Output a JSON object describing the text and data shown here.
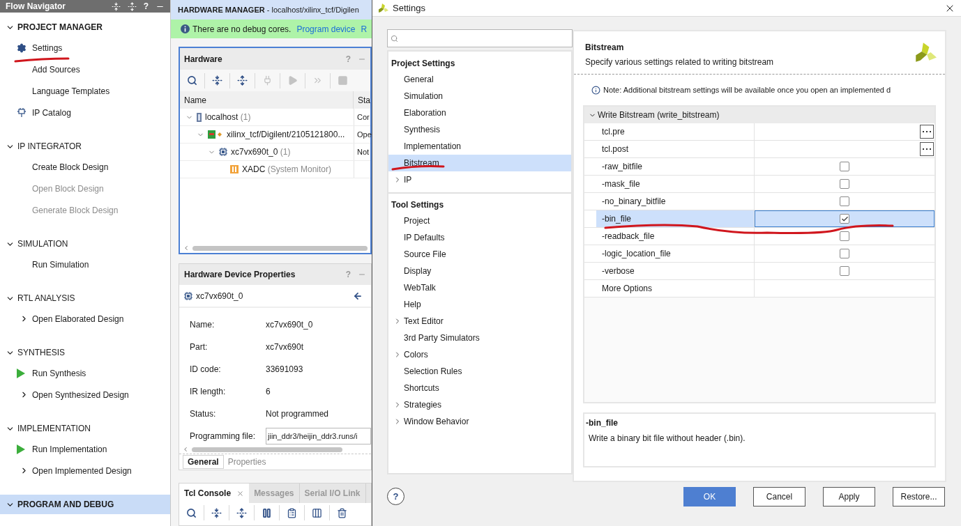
{
  "flow_navigator": {
    "title": "Flow Navigator",
    "help": "?",
    "sections": [
      {
        "title": "PROJECT MANAGER",
        "expanded": true,
        "active": true,
        "selected": false,
        "items": [
          {
            "label": "Settings",
            "kind": "gear",
            "disabled": false
          },
          {
            "label": "Add Sources",
            "kind": "plain",
            "disabled": false
          },
          {
            "label": "Language Templates",
            "kind": "plain",
            "disabled": false
          },
          {
            "label": "IP Catalog",
            "kind": "ip",
            "disabled": false
          }
        ]
      },
      {
        "title": "IP INTEGRATOR",
        "expanded": true,
        "active": false,
        "selected": false,
        "items": [
          {
            "label": "Create Block Design",
            "kind": "plain",
            "disabled": false
          },
          {
            "label": "Open Block Design",
            "kind": "plain",
            "disabled": true
          },
          {
            "label": "Generate Block Design",
            "kind": "plain",
            "disabled": true
          }
        ]
      },
      {
        "title": "SIMULATION",
        "expanded": true,
        "active": false,
        "selected": false,
        "items": [
          {
            "label": "Run Simulation",
            "kind": "plain",
            "disabled": false
          }
        ]
      },
      {
        "title": "RTL ANALYSIS",
        "expanded": true,
        "active": false,
        "selected": false,
        "items": [
          {
            "label": "Open Elaborated Design",
            "kind": "expandable",
            "disabled": false
          }
        ]
      },
      {
        "title": "SYNTHESIS",
        "expanded": true,
        "active": false,
        "selected": false,
        "items": [
          {
            "label": "Run Synthesis",
            "kind": "run",
            "disabled": false
          },
          {
            "label": "Open Synthesized Design",
            "kind": "expandable",
            "disabled": false
          }
        ]
      },
      {
        "title": "IMPLEMENTATION",
        "expanded": true,
        "active": false,
        "selected": false,
        "items": [
          {
            "label": "Run Implementation",
            "kind": "run",
            "disabled": false
          },
          {
            "label": "Open Implemented Design",
            "kind": "expandable",
            "disabled": false
          }
        ]
      },
      {
        "title": "PROGRAM AND DEBUG",
        "expanded": true,
        "active": true,
        "selected": true
      }
    ]
  },
  "hardware_manager": {
    "title": "**HARDWARE MANAGER** - localhost/xilinx_tcf/Digilen",
    "banner": {
      "message": "There are no debug cores.",
      "links": [
        "Program device",
        "R"
      ]
    },
    "hardware": {
      "title": "Hardware",
      "help": "?",
      "columns": [
        "Name",
        "Sta"
      ],
      "rows": [
        {
          "name": "localhost",
          "count": "(1)",
          "status": "Cor",
          "kind": "server",
          "expanded": true,
          "children": [
            {
              "name": "xilinx_tcf/Digilent/2105121800...",
              "status": "Ope",
              "kind": "board",
              "expanded": true,
              "children": [
                {
                  "name": "xc7vx690t_0",
                  "count": "(1)",
                  "status": "Not",
                  "kind": "device",
                  "expanded": true,
                  "children": [
                    {
                      "name": "XADC",
                      "count": "(System Monitor)",
                      "kind": "monitor"
                    }
                  ]
                }
              ]
            }
          ]
        }
      ]
    },
    "device_properties": {
      "title": "Hardware Device Properties",
      "help": "?",
      "device": "xc7vx690t_0",
      "properties": [
        {
          "label": "Name:",
          "value": "xc7vx690t_0",
          "kind": "text"
        },
        {
          "label": "Part:",
          "value": "xc7vx690t",
          "kind": "text"
        },
        {
          "label": "ID code:",
          "value": "33691093",
          "kind": "text"
        },
        {
          "label": "IR length:",
          "value": "6",
          "kind": "text"
        },
        {
          "label": "Status:",
          "value": "Not programmed",
          "kind": "text"
        },
        {
          "label": "Programming file:",
          "value": "jiin_ddr3/heijin_ddr3.runs/i",
          "kind": "field"
        }
      ],
      "tabs": [
        {
          "label": "General",
          "selected": true
        },
        {
          "label": "Properties",
          "selected": false
        }
      ]
    },
    "console": {
      "tabs": [
        {
          "label": "Tcl Console",
          "selected": true,
          "closable": true
        },
        {
          "label": "Messages",
          "selected": false,
          "closable": false
        },
        {
          "label": "Serial I/O Link",
          "selected": false,
          "closable": false
        }
      ]
    }
  },
  "settings_dialog": {
    "title": "Settings",
    "tree": [
      {
        "title": "Project Settings",
        "items": [
          {
            "label": "General",
            "kind": "leaf",
            "selected": false
          },
          {
            "label": "Simulation",
            "kind": "leaf",
            "selected": false
          },
          {
            "label": "Elaboration",
            "kind": "leaf",
            "selected": false
          },
          {
            "label": "Synthesis",
            "kind": "leaf",
            "selected": false
          },
          {
            "label": "Implementation",
            "kind": "leaf",
            "selected": false
          },
          {
            "label": "Bitstream",
            "kind": "leaf",
            "selected": true
          },
          {
            "label": "IP",
            "kind": "group",
            "selected": false
          }
        ]
      },
      {
        "title": "Tool Settings",
        "items": [
          {
            "label": "Project",
            "kind": "leaf",
            "selected": false
          },
          {
            "label": "IP Defaults",
            "kind": "leaf",
            "selected": false
          },
          {
            "label": "Source File",
            "kind": "leaf",
            "selected": false
          },
          {
            "label": "Display",
            "kind": "leaf",
            "selected": false
          },
          {
            "label": "WebTalk",
            "kind": "leaf",
            "selected": false
          },
          {
            "label": "Help",
            "kind": "leaf",
            "selected": false
          },
          {
            "label": "Text Editor",
            "kind": "group",
            "selected": false
          },
          {
            "label": "3rd Party Simulators",
            "kind": "leaf",
            "selected": false
          },
          {
            "label": "Colors",
            "kind": "group",
            "selected": false
          },
          {
            "label": "Selection Rules",
            "kind": "leaf",
            "selected": false
          },
          {
            "label": "Shortcuts",
            "kind": "leaf",
            "selected": false
          },
          {
            "label": "Strategies",
            "kind": "group",
            "selected": false
          },
          {
            "label": "Window Behavior",
            "kind": "group",
            "selected": false
          }
        ]
      }
    ],
    "help_button": "?",
    "page": {
      "title": "Bitstream",
      "description": "Specify various settings related to writing bitstream",
      "note": "Note: Additional bitstream settings will be available once you open an implemented d",
      "group": {
        "title": "Write Bitstream (write_bitstream)",
        "expanded": true
      },
      "rows": [
        {
          "name": "tcl.pre",
          "kind": "file",
          "selected": false
        },
        {
          "name": "tcl.post",
          "kind": "file",
          "selected": false
        },
        {
          "name": "-raw_bitfile",
          "kind": "checkbox",
          "checked": false,
          "selected": false
        },
        {
          "name": "-mask_file",
          "kind": "checkbox",
          "checked": false,
          "selected": false
        },
        {
          "name": "-no_binary_bitfile",
          "kind": "checkbox",
          "checked": false,
          "selected": false
        },
        {
          "name": "-bin_file",
          "kind": "checkbox",
          "checked": true,
          "selected": true
        },
        {
          "name": "-readback_file",
          "kind": "checkbox",
          "checked": false,
          "selected": false
        },
        {
          "name": "-logic_location_file",
          "kind": "checkbox",
          "checked": false,
          "selected": false
        },
        {
          "name": "-verbose",
          "kind": "checkbox",
          "checked": false,
          "selected": false
        },
        {
          "name": "More Options",
          "kind": "options",
          "selected": false
        }
      ],
      "help": {
        "title": "-bin_file",
        "text": "Write a binary bit file without header (.bin)."
      }
    },
    "buttons": [
      {
        "label": "OK",
        "kind": "primary"
      },
      {
        "label": "Cancel",
        "kind": "default"
      },
      {
        "label": "Apply",
        "kind": "default"
      },
      {
        "label": "Restore...",
        "kind": "default"
      }
    ]
  }
}
